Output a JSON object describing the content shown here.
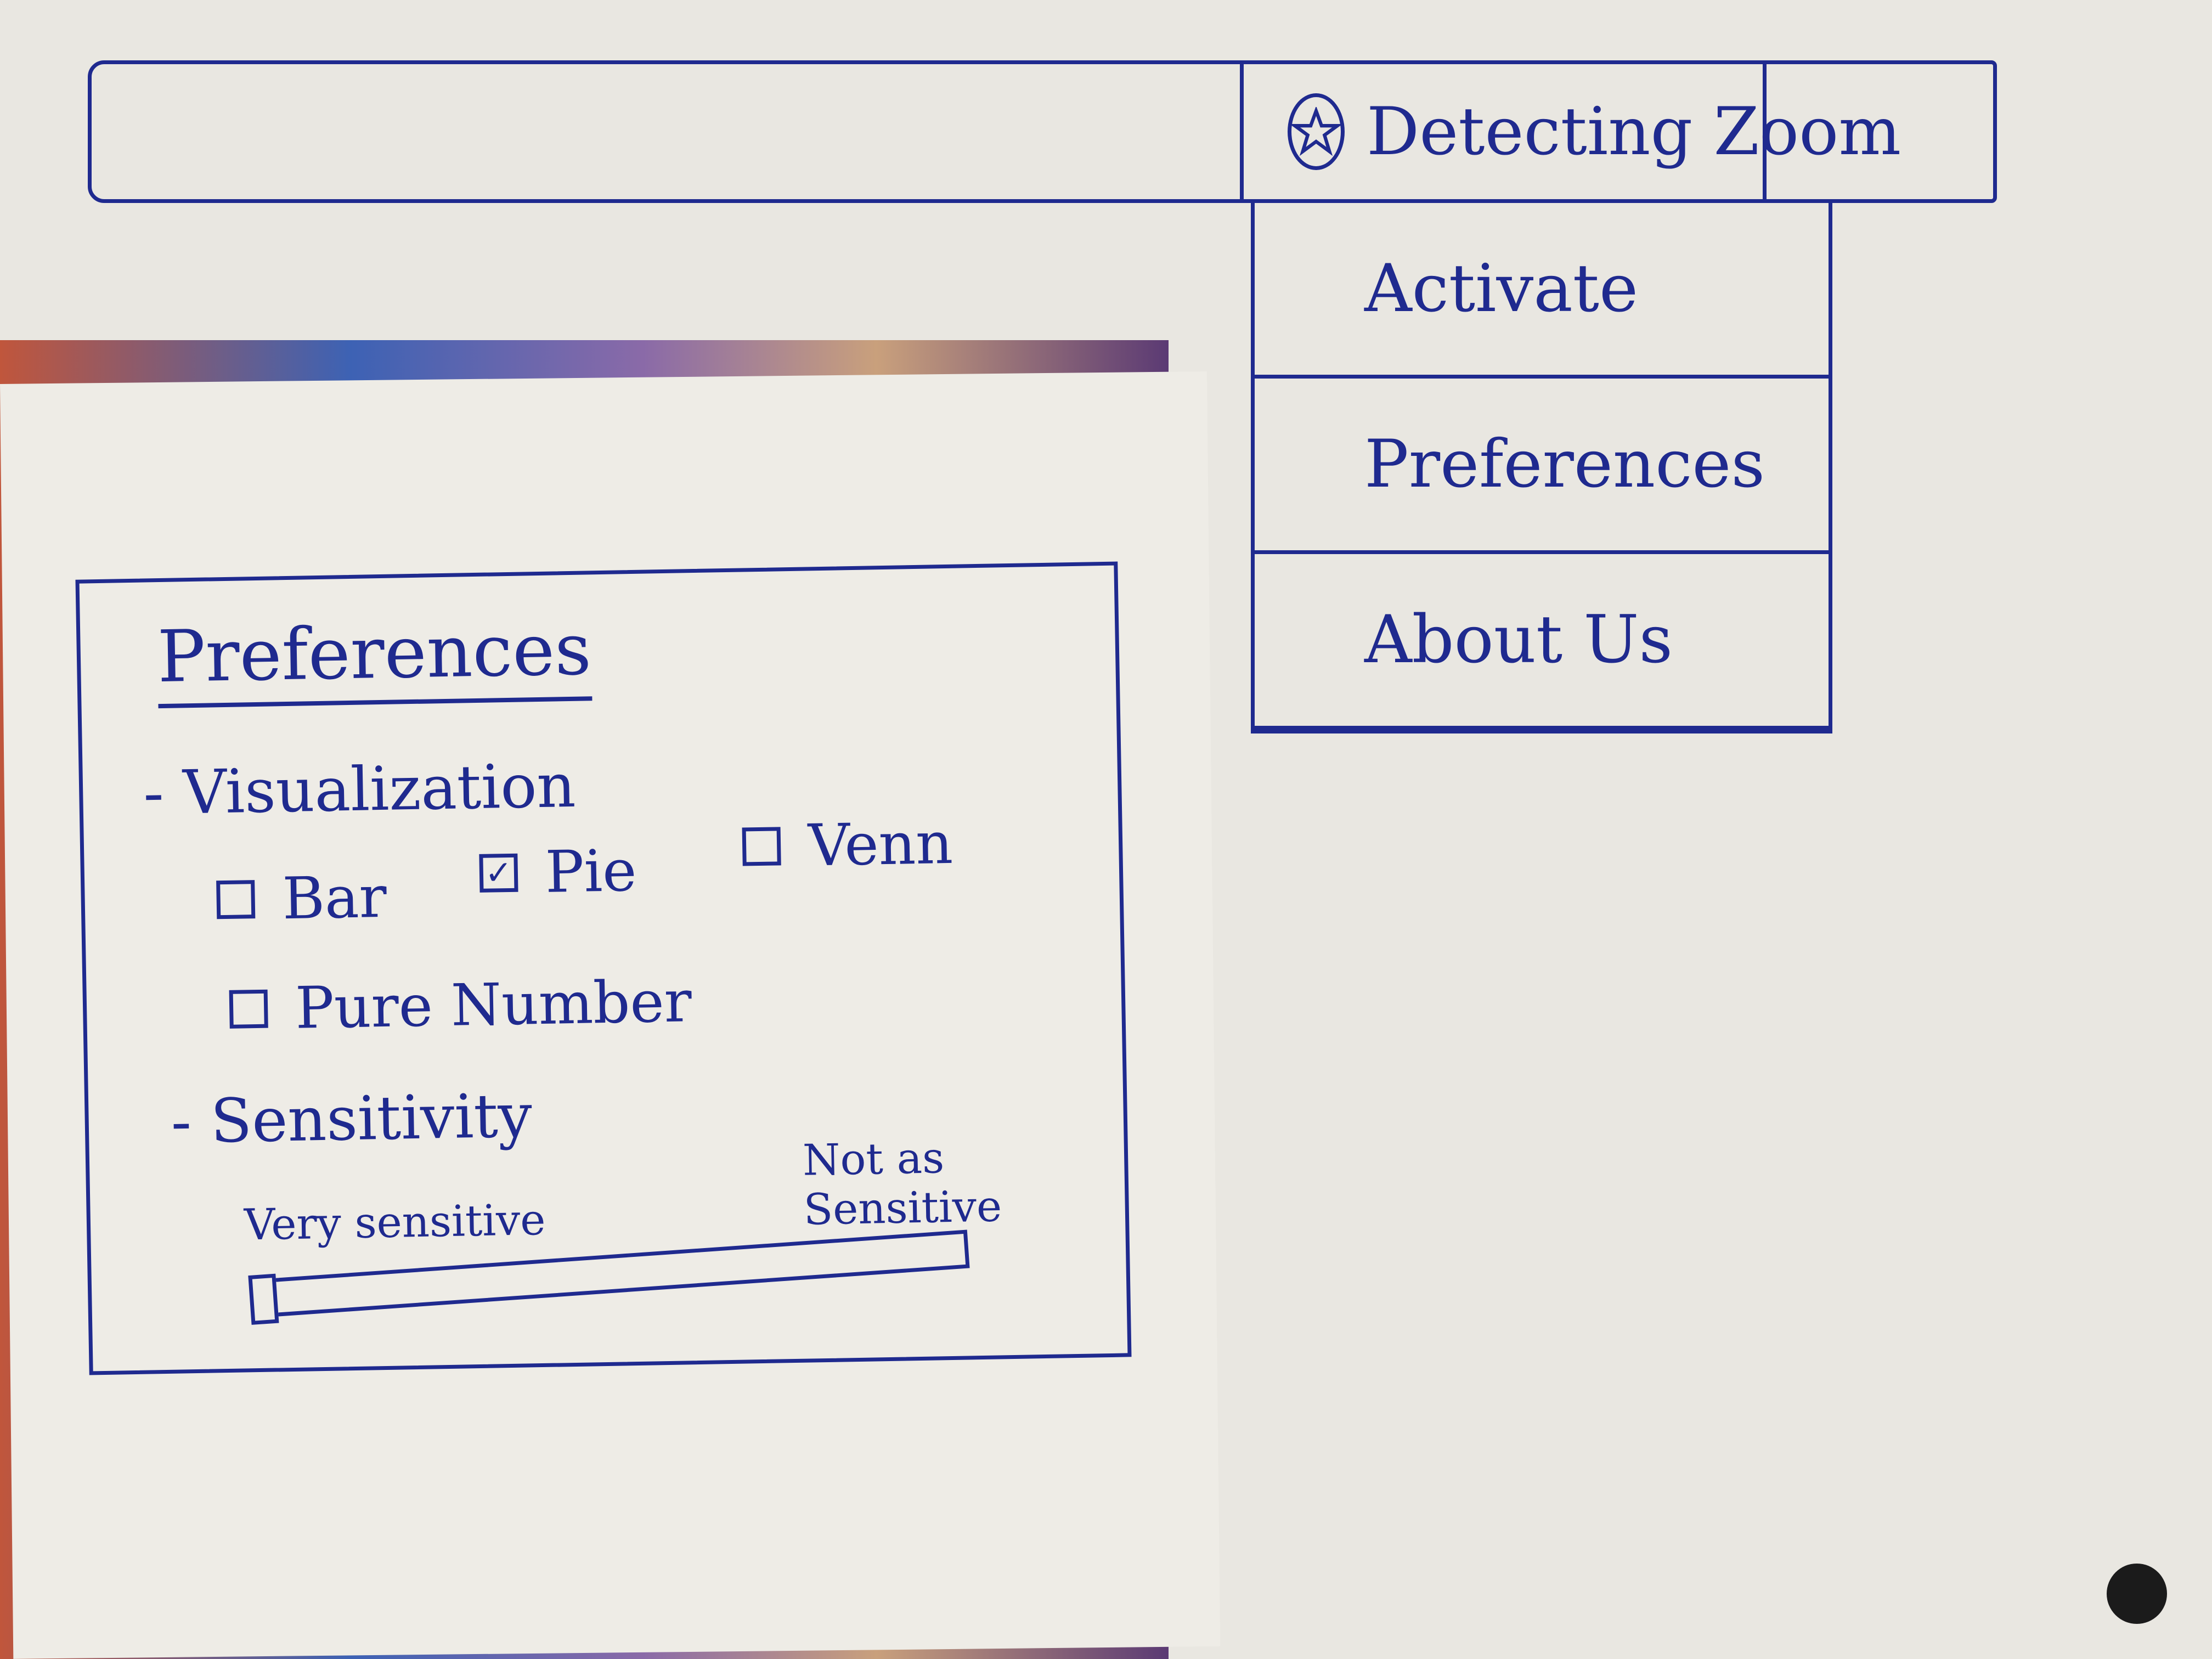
{
  "menubar": {
    "app_title": "Detecting Zoom",
    "app_icon": "star-circle-icon"
  },
  "dropdown": {
    "items": [
      {
        "label": "Activate"
      },
      {
        "label": "Preferences"
      },
      {
        "label": "About Us"
      }
    ]
  },
  "preferences": {
    "title": "Preferences",
    "visualization": {
      "title": "- Visualization",
      "options": [
        {
          "label": "Bar",
          "checked": false
        },
        {
          "label": "Pie",
          "checked": true
        },
        {
          "label": "Venn",
          "checked": false
        },
        {
          "label": "Pure Number",
          "checked": false
        }
      ]
    },
    "sensitivity": {
      "title": "- Sensitivity",
      "min_label": "Very sensitive",
      "max_label": "Not as Sensitive",
      "value": 0
    }
  },
  "colors": {
    "ink": "#1f2a8f",
    "paper": "#eeece6"
  }
}
